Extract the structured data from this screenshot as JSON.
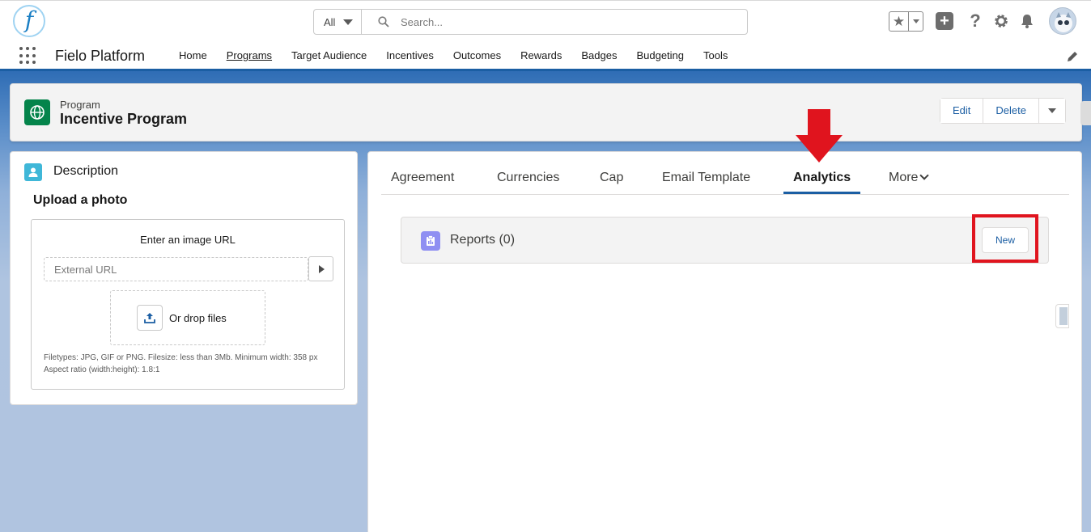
{
  "header": {
    "logo_letter": "f",
    "search_scope": "All",
    "search_placeholder": "Search...",
    "icons": [
      "favorites-star-icon",
      "add-icon",
      "help-icon",
      "setup-gear-icon",
      "notifications-bell-icon",
      "avatar"
    ]
  },
  "nav": {
    "app_name": "Fielo Platform",
    "items": [
      "Home",
      "Programs",
      "Target Audience",
      "Incentives",
      "Outcomes",
      "Rewards",
      "Badges",
      "Budgeting",
      "Tools"
    ],
    "active": "Programs"
  },
  "record": {
    "type": "Program",
    "title": "Incentive Program",
    "actions": [
      "Edit",
      "Delete"
    ]
  },
  "description_card": {
    "title": "Description",
    "upload_title": "Upload a photo",
    "url_label": "Enter an image URL",
    "url_placeholder": "External URL",
    "drop_label": "Or drop files",
    "hint_line1": "Filetypes: JPG, GIF or PNG. Filesize: less than 3Mb. Minimum width: 358 px",
    "hint_line2": "Aspect ratio (width:height): 1.8:1"
  },
  "tabs": {
    "items": [
      "Agreement",
      "Currencies",
      "Cap",
      "Email Template",
      "Analytics",
      "More"
    ],
    "active": "Analytics"
  },
  "reports": {
    "title": "Reports (0)",
    "new_label": "New"
  },
  "colors": {
    "brand_blue": "#1b5ea3",
    "record_icon": "#04844b",
    "annotation_red": "#e0141e",
    "reports_icon": "#8f8ff2"
  }
}
